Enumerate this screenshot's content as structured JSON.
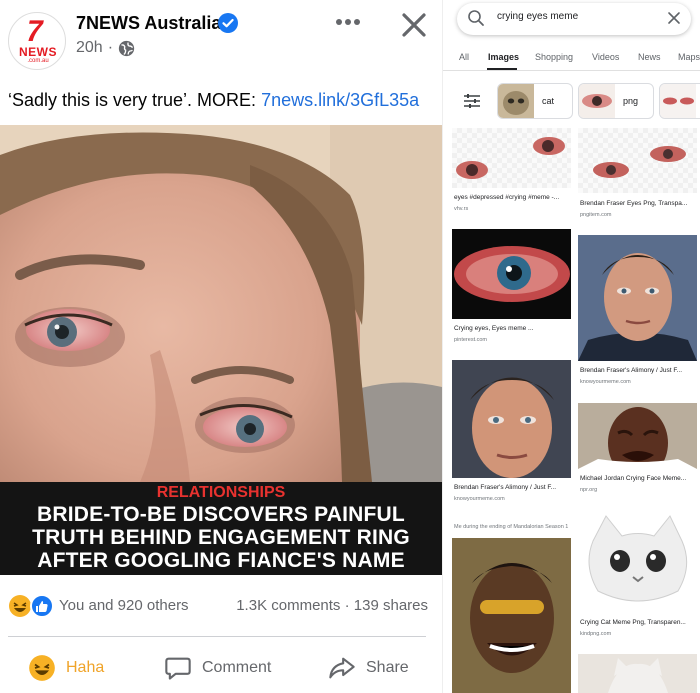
{
  "post": {
    "page_name": "7NEWS Australia",
    "time": "20h",
    "avatar_logo": {
      "number": "7",
      "word": "NEWS",
      "domain": ".com.au"
    },
    "text": "‘Sadly this is very true’. MORE: ",
    "link": "7news.link/3GfL35a",
    "headline_kicker": "RELATIONSHIPS",
    "headline_lines": [
      "BRIDE-TO-BE DISCOVERS PAINFUL",
      "TRUTH BEHIND ENGAGEMENT RING",
      "AFTER GOOGLING FIANCE'S NAME"
    ],
    "reactions_text": "You and 920 others",
    "comments": "1.3K comments",
    "shares": "139 shares",
    "actions": {
      "haha": "Haha",
      "comment": "Comment",
      "share": "Share"
    },
    "colors": {
      "link": "#216fdb",
      "haha": "#f0a429",
      "kicker": "#e8322f",
      "brand": "#e41b23",
      "verified": "#1877f2"
    }
  },
  "google": {
    "query": "crying eyes meme",
    "tabs": [
      "All",
      "Images",
      "Shopping",
      "Videos",
      "News",
      "Maps"
    ],
    "active_tab": "Images",
    "chips": [
      "cat",
      "png"
    ],
    "results": [
      {
        "caption": "eyes #depressed #crying #meme -...",
        "source": "vhv.rs"
      },
      {
        "caption": "Brendan Fraser Eyes Png, Transpa...",
        "source": "pngitem.com"
      },
      {
        "caption": "Crying eyes, Eyes meme ...",
        "source": "pinterest.com"
      },
      {
        "caption": "Brendan Fraser's Alimony / Just F...",
        "source": "knowyourmeme.com"
      },
      {
        "caption": "Brendan Fraser's Alimony / Just F...",
        "source": "knowyourmeme.com"
      },
      {
        "caption": "Michael Jordan Crying Face Meme...",
        "source": "npr.org"
      },
      {
        "caption": "Me during the ending of Mandalorian Season 1",
        "source": ""
      },
      {
        "caption": "Crying Cat Meme Png, Transparen...",
        "source": "kindpng.com"
      }
    ]
  }
}
